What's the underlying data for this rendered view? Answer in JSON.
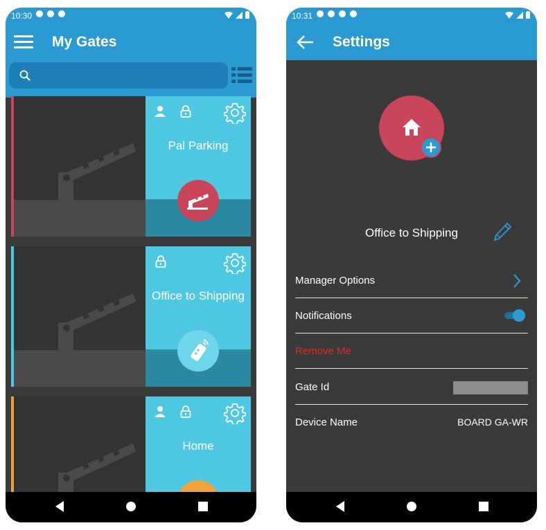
{
  "left": {
    "status_time": "10:30",
    "title": "My Gates",
    "search_placeholder": "",
    "gates": [
      {
        "name": "Pal Parking",
        "stripe": "#c8455a",
        "action_color": "#c8455a",
        "action_icon": "gate-barrier-icon",
        "has_user": true
      },
      {
        "name": "Office to Shipping",
        "stripe": "#4fc9e3",
        "action_color": "#6fd5ea",
        "action_icon": "remote-control-icon",
        "has_user": false
      },
      {
        "name": "Home",
        "stripe": "#f0a33c",
        "action_color": "#f0a33c",
        "action_icon": "gate-icon",
        "has_user": true
      }
    ]
  },
  "right": {
    "status_time": "10:31",
    "title": "Settings",
    "gate_title": "Office to Shipping",
    "rows": {
      "manager_options": "Manager Options",
      "notifications": "Notifications",
      "remove_me": "Remove Me",
      "gate_id": "Gate Id",
      "device_name_label": "Device Name",
      "device_name_value": "BOARD GA-WR"
    },
    "notifications_on": true
  },
  "colors": {
    "primary": "#2b9ad3",
    "tile": "#4fc9e3",
    "danger": "#e02a2a",
    "dark_bg": "#3a3a3a"
  }
}
